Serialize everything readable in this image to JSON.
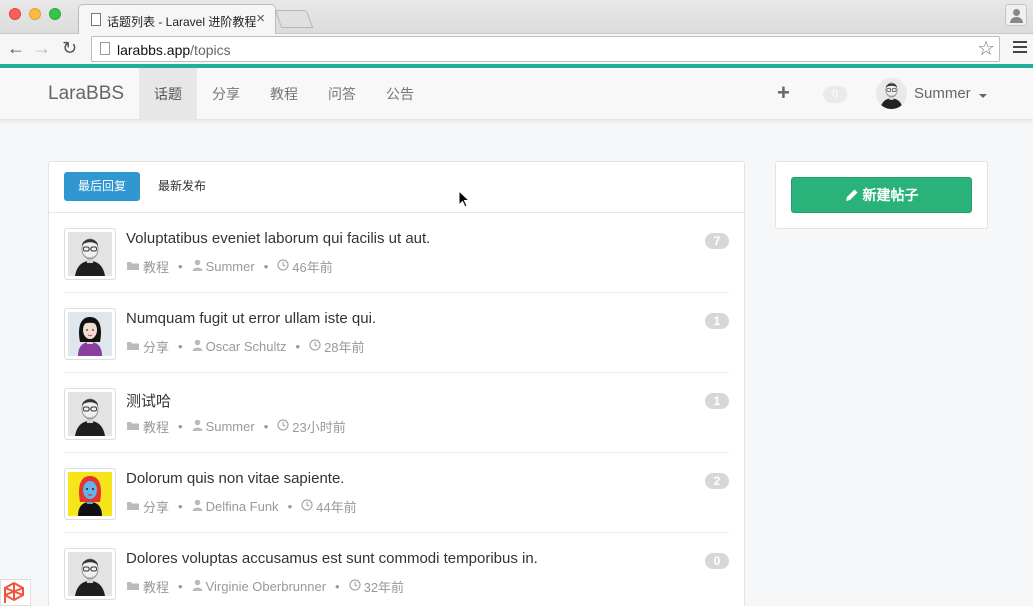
{
  "browser": {
    "tab_title": "话题列表 - Laravel 进阶教程",
    "tab_close": "×",
    "url_host": "larabbs.app",
    "url_path": "/topics"
  },
  "nav": {
    "brand": "LaraBBS",
    "items": [
      {
        "label": "话题",
        "active": true
      },
      {
        "label": "分享",
        "active": false
      },
      {
        "label": "教程",
        "active": false
      },
      {
        "label": "问答",
        "active": false
      },
      {
        "label": "公告",
        "active": false
      }
    ],
    "plus": "+",
    "notification_count": "0",
    "username": "Summer"
  },
  "panel": {
    "tabs": [
      {
        "label": "最后回复",
        "active": true
      },
      {
        "label": "最新发布",
        "active": false
      }
    ]
  },
  "topics": [
    {
      "title": "Voluptatibus eveniet laborum qui facilis ut aut.",
      "category": "教程",
      "author": "Summer",
      "time": "46年前",
      "replies": "7",
      "avatar": "man-glasses"
    },
    {
      "title": "Numquam fugit ut error ullam iste qui.",
      "category": "分享",
      "author": "Oscar Schultz",
      "time": "28年前",
      "replies": "1",
      "avatar": "woman-black-hair"
    },
    {
      "title": "测试哈",
      "category": "教程",
      "author": "Summer",
      "time": "23小时前",
      "replies": "1",
      "avatar": "man-glasses"
    },
    {
      "title": "Dolorum quis non vitae sapiente.",
      "category": "分享",
      "author": "Delfina Funk",
      "time": "44年前",
      "replies": "2",
      "avatar": "woman-red-hair"
    },
    {
      "title": "Dolores voluptas accusamus est sunt commodi temporibus in.",
      "category": "教程",
      "author": "Virginie Oberbrunner",
      "time": "32年前",
      "replies": "0",
      "avatar": "man-glasses"
    }
  ],
  "sidebar": {
    "new_topic": "新建帖子"
  },
  "meta_separator": "•",
  "colors": {
    "accent": "#3097d1",
    "success": "#2ab27b",
    "topline": "#1faf9a"
  }
}
